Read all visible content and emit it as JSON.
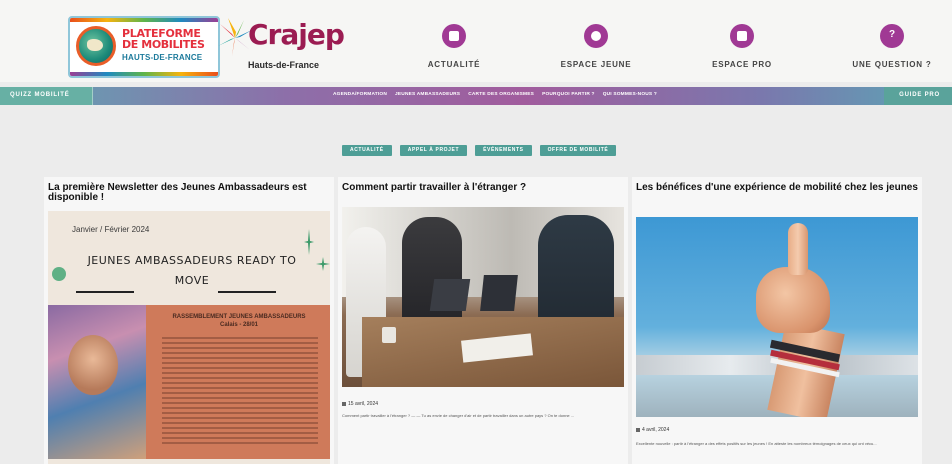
{
  "header": {
    "logo_plateforme": {
      "line1": "PLATEFORME",
      "line2": "DE MOBILITES",
      "line3": "HAUTS-DE-FRANCE"
    },
    "logo_crajep": {
      "name": "Crajep",
      "region": "Hauts-de-France"
    },
    "nav": [
      {
        "label": "ACTUALITÉ",
        "icon": "document-icon"
      },
      {
        "label": "ESPACE JEUNE",
        "icon": "people-icon"
      },
      {
        "label": "ESPACE PRO",
        "icon": "briefcase-icon"
      },
      {
        "label": "UNE QUESTION ?",
        "icon": "question-icon",
        "glyph": "?"
      }
    ],
    "accent_color": "#a03994"
  },
  "subnav": {
    "left_label": "QUIZZ MOBILITÉ",
    "right_label": "GUIDE PRO",
    "links": [
      "AGENDA/FORMATION",
      "JEUNES AMBASSADEURS",
      "CARTE DES ORGANISMES",
      "POURQUOI PARTIR ?",
      "QUI SOMMES-NOUS ?"
    ]
  },
  "filters": [
    "ACTUALITÉ",
    "APPEL À PROJET",
    "ÉVÉNEMENTS",
    "OFFRE DE MOBILITÉ"
  ],
  "cards": [
    {
      "title": "La première Newsletter des Jeunes Ambassadeurs est disponible !",
      "image": {
        "date": "Janvier / Février 2024",
        "headline": "JEUNES AMBASSADEURS READY TO MOVE",
        "subheading": "RASSEMBLEMENT JEUNES AMBASSADEURS Calais - 28/01"
      }
    },
    {
      "title": "Comment partir travailler à l'étranger ?",
      "date": "15 avril, 2024",
      "excerpt": "Comment partir travailler à l'étranger ? — — Tu as envie de changer d'air et de partir travailler dans un autre pays ? On te donne ..."
    },
    {
      "title": "Les bénéfices d'une expérience de mobilité chez les jeunes",
      "date": "4 avril, 2024",
      "excerpt": "Excellente nouvelle : partir à l'étranger a des effets positifs sur les jeunes ! En atteste les nombreux témoignages de ceux qui ont vécu..."
    }
  ],
  "colors": {
    "filter_button": "#4e9e96",
    "subnav_gradient": [
      "#5fa7b4",
      "#a15c9d",
      "#5ba7b6"
    ]
  }
}
